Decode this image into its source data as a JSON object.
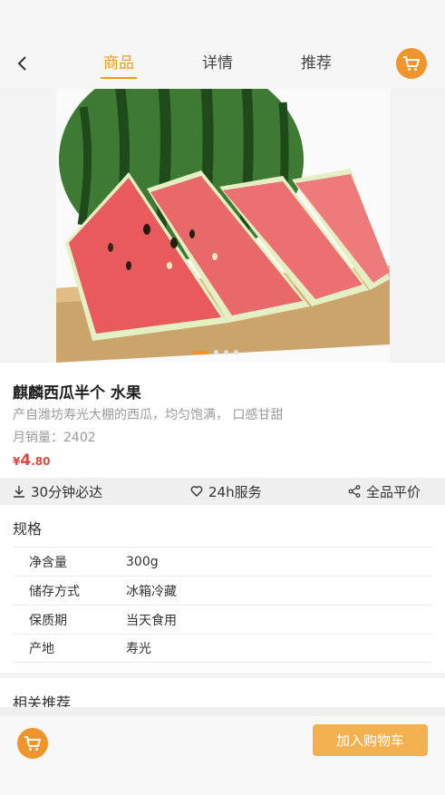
{
  "header": {
    "back_icon": "chevron-left-icon",
    "tabs": [
      {
        "label": "商品",
        "active": true
      },
      {
        "label": "详情",
        "active": false
      },
      {
        "label": "推荐",
        "active": false
      }
    ],
    "cart_icon": "shopping-cart-icon"
  },
  "carousel": {
    "image": "watermelon-slices",
    "slide_count": 4,
    "active_index": 0
  },
  "product": {
    "name": "麒麟西瓜半个 水果",
    "description": "产自潍坊寿光大棚的西瓜，均匀饱满， 口感甘甜",
    "sales_label": "月销量：",
    "sales_count": "2402",
    "price_symbol": "¥",
    "price_integer": "4",
    "price_decimal": ".80"
  },
  "services": [
    {
      "icon": "download-icon",
      "label": "30分钟必达"
    },
    {
      "icon": "heart-icon",
      "label": "24h服务"
    },
    {
      "icon": "share-icon",
      "label": "全品平价"
    }
  ],
  "specs": {
    "title": "规格",
    "rows": [
      {
        "key": "净含量",
        "value": "300g"
      },
      {
        "key": "储存方式",
        "value": "冰箱冷藏"
      },
      {
        "key": "保质期",
        "value": "当天食用"
      },
      {
        "key": "产地",
        "value": "寿光"
      }
    ]
  },
  "related": {
    "title": "相关推荐"
  },
  "footer": {
    "cart_icon": "shopping-cart-icon",
    "add_to_cart_label": "加入购物车"
  },
  "colors": {
    "accent": "#f0952c",
    "price": "#e0463f",
    "button": "#f3b04e"
  }
}
